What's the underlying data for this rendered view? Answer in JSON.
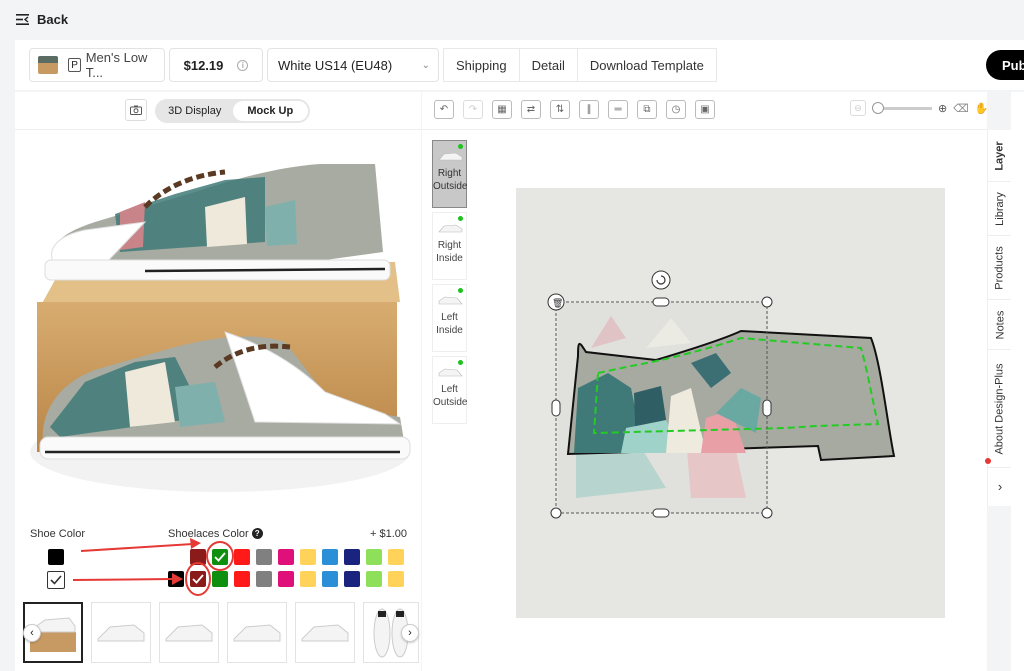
{
  "nav": {
    "back_label": "Back"
  },
  "toolbar": {
    "product_badge": "P",
    "product_name": "Men's Low T...",
    "price": "$12.19",
    "variant": "White US14 (EU48)",
    "shipping": "Shipping",
    "detail": "Detail",
    "download_template": "Download Template",
    "publish": "Pub"
  },
  "left": {
    "view_tabs": [
      "3D Display",
      "Mock Up"
    ],
    "active_view": "Mock Up",
    "shoe_color_label": "Shoe Color",
    "laces_color_label": "Shoelaces Color",
    "laces_price": "+ $1.00",
    "shoe_colors": [
      "#000000",
      "#ffffff"
    ],
    "lace_colors_row1": [
      "#8b1a1a",
      "#0f8f0f",
      "#ff1a1a",
      "#808080",
      "#e0107a",
      "#ffd25a",
      "#2a8fd6",
      "#1a237e",
      "#8ee05a",
      "#ffd25a"
    ],
    "lace_colors_row2": [
      "#000000",
      "#8b1a1a",
      "#0f8f0f",
      "#ff1a1a",
      "#808080",
      "#e0107a",
      "#ffd25a",
      "#2a8fd6",
      "#1a237e",
      "#8ee05a",
      "#ffd25a"
    ]
  },
  "editor": {
    "views": [
      {
        "label": "Right Outside",
        "active": true
      },
      {
        "label": "Right Inside",
        "active": false
      },
      {
        "label": "Left Inside",
        "active": false
      },
      {
        "label": "Left Outside",
        "active": false
      }
    ]
  },
  "right_tabs": [
    "Layer",
    "Library",
    "Products",
    "Notes",
    "About Design-Plus"
  ]
}
